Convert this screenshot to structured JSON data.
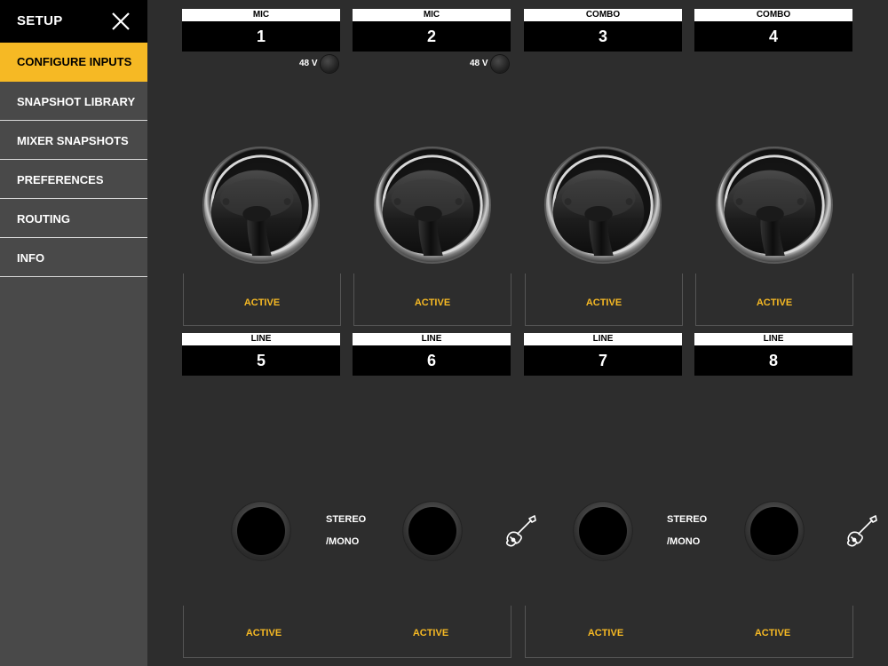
{
  "sidebar": {
    "title": "SETUP",
    "items": [
      {
        "label": "CONFIGURE INPUTS",
        "active": true
      },
      {
        "label": "SNAPSHOT LIBRARY",
        "active": false
      },
      {
        "label": "MIXER SNAPSHOTS",
        "active": false
      },
      {
        "label": "PREFERENCES",
        "active": false
      },
      {
        "label": "ROUTING",
        "active": false
      },
      {
        "label": "INFO",
        "active": false
      }
    ]
  },
  "inputs_top": [
    {
      "type": "MIC",
      "number": "1",
      "phantom_label": "48 V",
      "status": "ACTIVE"
    },
    {
      "type": "MIC",
      "number": "2",
      "phantom_label": "48 V",
      "status": "ACTIVE"
    },
    {
      "type": "COMBO",
      "number": "3",
      "status": "ACTIVE"
    },
    {
      "type": "COMBO",
      "number": "4",
      "status": "ACTIVE"
    }
  ],
  "inputs_bottom": [
    {
      "type": "LINE",
      "number": "5"
    },
    {
      "type": "LINE",
      "number": "6"
    },
    {
      "type": "LINE",
      "number": "7"
    },
    {
      "type": "LINE",
      "number": "8"
    }
  ],
  "line_pairs": [
    {
      "mode_line1": "STEREO",
      "mode_line2": "/MONO",
      "status_left": "ACTIVE",
      "status_right": "ACTIVE"
    },
    {
      "mode_line1": "STEREO",
      "mode_line2": "/MONO",
      "status_left": "ACTIVE",
      "status_right": "ACTIVE"
    }
  ],
  "colors": {
    "accent": "#f6b924",
    "sidebar": "#494949",
    "background": "#2d2d2d"
  },
  "icons": {
    "close": "close-icon",
    "instrument": "guitar-icon"
  }
}
